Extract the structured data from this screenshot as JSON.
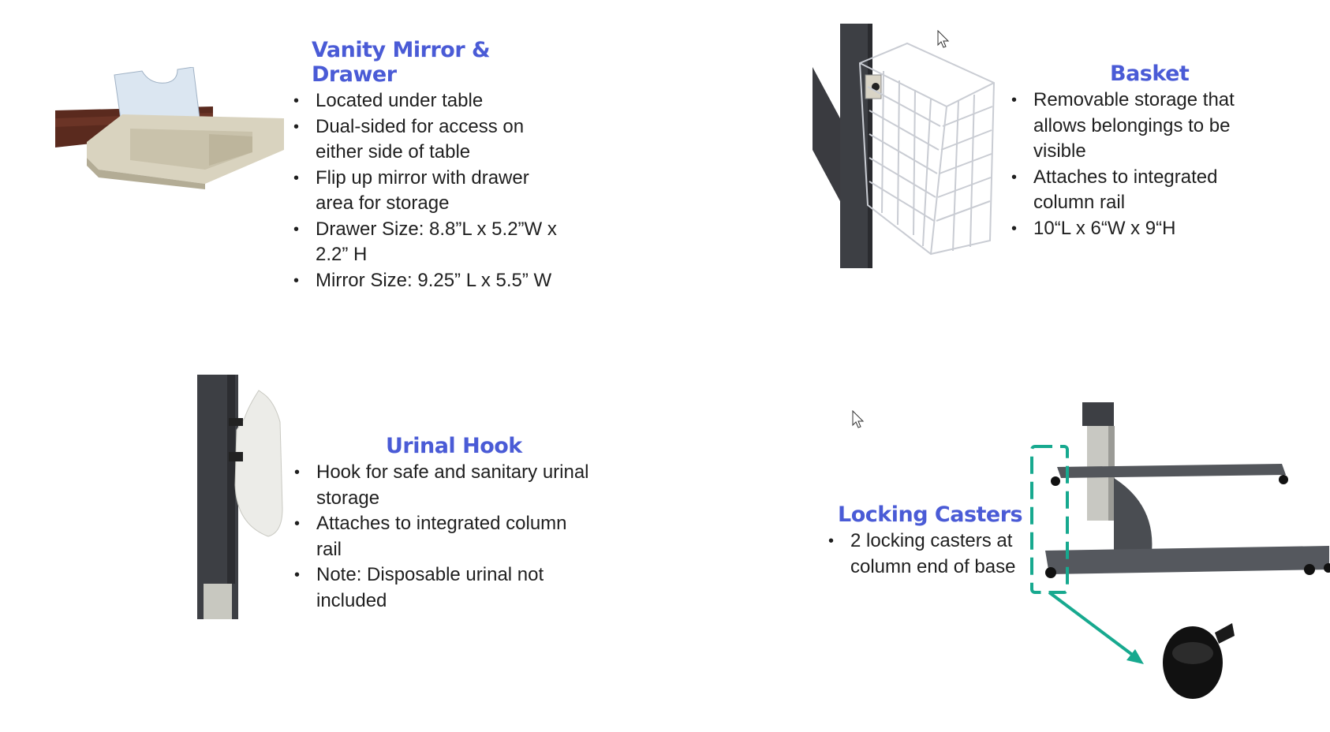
{
  "sections": {
    "vanity": {
      "title": "Vanity Mirror & Drawer",
      "items": [
        "Located under table",
        "Dual-sided for access on either side of table",
        "Flip up mirror with drawer area for storage",
        "Drawer Size: 8.8”L x 5.2”W x 2.2” H",
        "Mirror Size: 9.25” L x 5.5” W"
      ]
    },
    "basket": {
      "title": "Basket",
      "items": [
        "Removable storage that allows belongings to be visible",
        "Attaches to integrated column rail",
        "10“L x 6“W x 9“H"
      ]
    },
    "urinal": {
      "title": "Urinal Hook",
      "items": [
        "Hook for safe and sanitary urinal storage",
        "Attaches to integrated column rail",
        "Note: Disposable urinal not included"
      ]
    },
    "casters": {
      "title": "Locking Casters",
      "items": [
        "2 locking casters at column end of base"
      ]
    }
  },
  "colors": {
    "title": "#4a5bd6",
    "highlight": "#17a98f",
    "column": "#3d3f44"
  },
  "icons": [
    "cursor-arrow-icon",
    "cursor-arrow-icon"
  ]
}
